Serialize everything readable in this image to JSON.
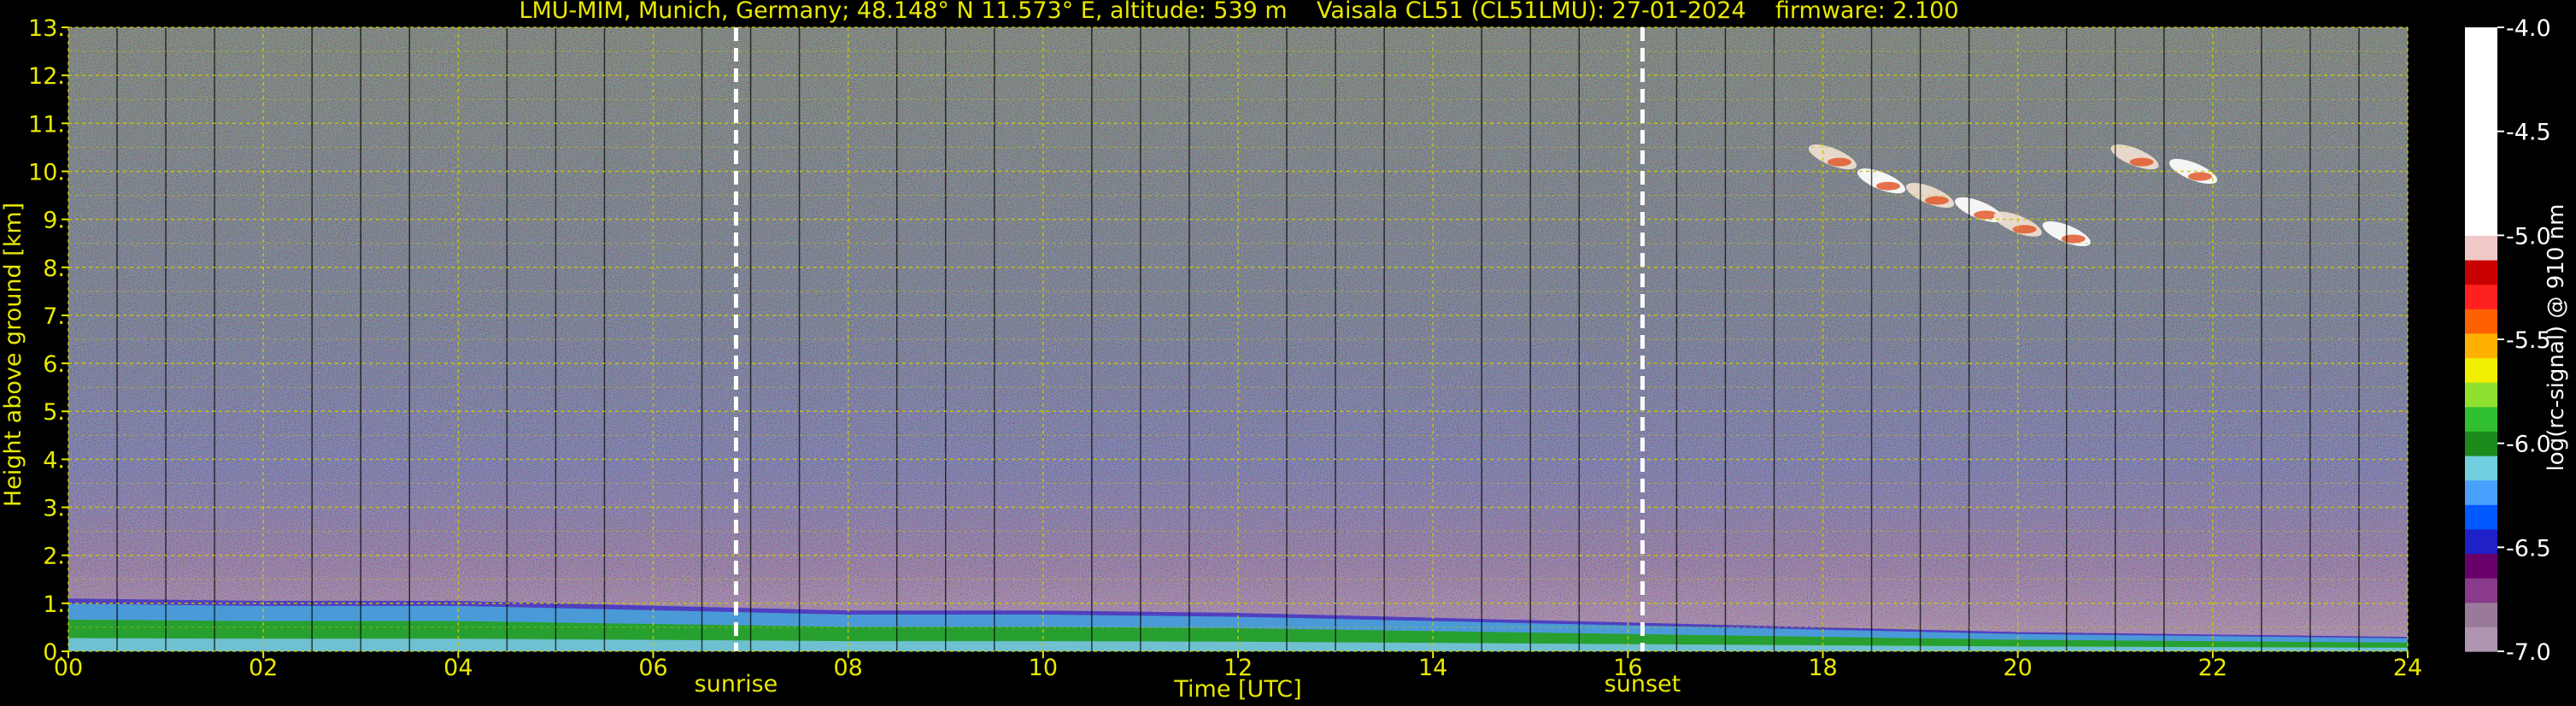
{
  "chart_data": {
    "type": "heatmap",
    "title": "LMU-MIM, Munich, Germany; 48.148° N 11.573° E, altitude: 539 m    Vaisala CL51 (CL51LMU): 27-01-2024    firmware: 2.100",
    "xlabel": "Time [UTC]",
    "ylabel": "Height above ground [km]",
    "xlim": [
      0,
      24
    ],
    "ylim": [
      0,
      13
    ],
    "x_ticks": [
      "00",
      "02",
      "04",
      "06",
      "08",
      "10",
      "12",
      "14",
      "16",
      "18",
      "20",
      "22",
      "24"
    ],
    "y_ticks": [
      "0.",
      "1.",
      "2.",
      "3.",
      "4.",
      "5.",
      "6.",
      "7.",
      "8.",
      "9.",
      "10.",
      "11.",
      "12.",
      "13."
    ],
    "grid": true,
    "markers": [
      {
        "label": "sunrise",
        "x": 6.85
      },
      {
        "label": "sunset",
        "x": 16.15
      }
    ],
    "colorbar": {
      "label": "log(rc-signal) @ 910 nm",
      "range": [
        -7.0,
        -4.0
      ],
      "ticks": [
        "-4.0",
        "-4.5",
        "-5.0",
        "-5.5",
        "-6.0",
        "-6.5",
        "-7.0"
      ],
      "tick_values": [
        -4.0,
        -4.5,
        -5.0,
        -5.5,
        -6.0,
        -6.5,
        -7.0
      ],
      "colors": [
        "#b095b0",
        "#9a7a9a",
        "#8a3a8a",
        "#6a006a",
        "#2020c8",
        "#0058ff",
        "#4aa0ff",
        "#70d0e0",
        "#1a8a1a",
        "#30c030",
        "#90e030",
        "#f0f000",
        "#ffb000",
        "#ff6000",
        "#ff2020",
        "#c80000",
        "#f0c8c8",
        "#ffffff"
      ]
    },
    "boundary_layer": [
      {
        "x": 0,
        "top": 1.1
      },
      {
        "x": 2,
        "top": 1.05
      },
      {
        "x": 4,
        "top": 1.05
      },
      {
        "x": 6,
        "top": 0.95
      },
      {
        "x": 8,
        "top": 0.85
      },
      {
        "x": 10,
        "top": 0.85
      },
      {
        "x": 12,
        "top": 0.8
      },
      {
        "x": 14,
        "top": 0.7
      },
      {
        "x": 16,
        "top": 0.6
      },
      {
        "x": 18,
        "top": 0.5
      },
      {
        "x": 20,
        "top": 0.4
      },
      {
        "x": 22,
        "top": 0.35
      },
      {
        "x": 24,
        "top": 0.3
      }
    ],
    "cirrus": [
      {
        "x": 18.1,
        "y": 10.3
      },
      {
        "x": 18.6,
        "y": 9.8
      },
      {
        "x": 19.1,
        "y": 9.5
      },
      {
        "x": 19.6,
        "y": 9.2
      },
      {
        "x": 20.0,
        "y": 8.9
      },
      {
        "x": 20.5,
        "y": 8.7
      },
      {
        "x": 21.2,
        "y": 10.3
      },
      {
        "x": 21.8,
        "y": 10.0
      }
    ]
  }
}
